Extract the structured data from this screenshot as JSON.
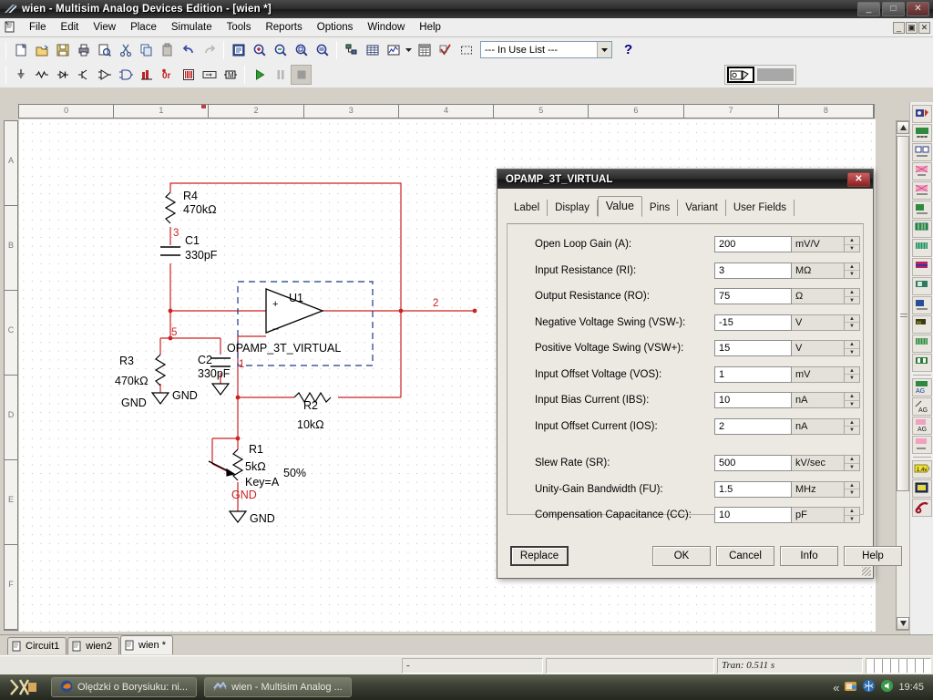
{
  "window": {
    "title": "wien - Multisim Analog Devices Edition - [wien *]",
    "minimize": "_",
    "maximize": "□",
    "close": "✕",
    "mdi_minimize": "_",
    "mdi_restore": "▣",
    "mdi_close": "✕"
  },
  "menu": {
    "items": [
      "File",
      "Edit",
      "View",
      "Place",
      "Simulate",
      "Tools",
      "Reports",
      "Options",
      "Window",
      "Help"
    ]
  },
  "toolbar": {
    "standard": [
      {
        "name": "new-file-icon",
        "label": "New"
      },
      {
        "name": "open-file-icon",
        "label": "Open"
      },
      {
        "name": "save-icon",
        "label": "Save"
      },
      {
        "name": "print-icon",
        "label": "Print"
      },
      {
        "name": "print-preview-icon",
        "label": "Print Preview"
      },
      {
        "name": "cut-icon",
        "label": "Cut"
      },
      {
        "name": "copy-icon",
        "label": "Copy"
      },
      {
        "name": "paste-icon",
        "label": "Paste"
      },
      {
        "name": "undo-icon",
        "label": "Undo"
      },
      {
        "name": "redo-icon",
        "label": "Redo"
      }
    ],
    "view": [
      {
        "name": "full-screen-icon",
        "label": "Toggle full screen"
      },
      {
        "name": "zoom-in-icon",
        "label": "Zoom In"
      },
      {
        "name": "zoom-out-icon",
        "label": "Zoom Out"
      },
      {
        "name": "zoom-area-icon",
        "label": "Zoom Area"
      },
      {
        "name": "zoom-fit-icon",
        "label": "Zoom Fit to page"
      }
    ],
    "design": [
      {
        "name": "design-toolbox-icon",
        "label": "Design Toolbox"
      },
      {
        "name": "spreadsheet-view-icon",
        "label": "Spreadsheet View"
      },
      {
        "name": "grapher-icon",
        "label": "Grapher"
      },
      {
        "name": "grapher-dropdown-icon",
        "label": "Analyses"
      },
      {
        "name": "postprocessor-icon",
        "label": "Postprocessor"
      },
      {
        "name": "erc-icon",
        "label": "Electrical Rules Check"
      },
      {
        "name": "area-capture-icon",
        "label": "Capture Screen Area"
      }
    ],
    "in_use_list": {
      "value": "--- In Use List ---",
      "options": [
        "--- In Use List ---"
      ]
    },
    "help_button": "?",
    "components": [
      {
        "name": "source-icon",
        "label": "Place Source"
      },
      {
        "name": "basic-icon",
        "label": "Place Basic"
      },
      {
        "name": "diode-icon",
        "label": "Place Diode"
      },
      {
        "name": "transistor-icon",
        "label": "Place Transistor"
      },
      {
        "name": "analog-icon",
        "label": "Place Analog"
      },
      {
        "name": "ttl-icon",
        "label": "Place TTL"
      },
      {
        "name": "cmos-icon",
        "label": "Place CMOS"
      },
      {
        "name": "misc-digital-icon",
        "label": "Place Misc Digital"
      },
      {
        "name": "mixed-icon",
        "label": "Place Mixed"
      },
      {
        "name": "indicator-icon",
        "label": "Place Indicator"
      },
      {
        "name": "misc-icon",
        "label": "Place Misc"
      }
    ],
    "simulation": [
      {
        "name": "run-icon",
        "label": "Run"
      },
      {
        "name": "pause-icon",
        "label": "Pause"
      },
      {
        "name": "stop-icon",
        "label": "Stop"
      }
    ],
    "probe_widget": {
      "name": "measurement-probe-icon",
      "label": "Measurement Probe"
    }
  },
  "rulers": {
    "horizontal": [
      "0",
      "1",
      "2",
      "3",
      "4",
      "5",
      "6",
      "7",
      "8"
    ],
    "vertical": [
      "A",
      "B",
      "C",
      "D",
      "E",
      "F"
    ]
  },
  "schematic": {
    "components": [
      {
        "ref": "R4",
        "value": "470kΩ"
      },
      {
        "ref": "C1",
        "value": "330pF"
      },
      {
        "ref": "R3",
        "value": "470kΩ"
      },
      {
        "ref": "C2",
        "value": "330pF"
      },
      {
        "ref": "U1",
        "value": "OPAMP_3T_VIRTUAL"
      },
      {
        "ref": "R2",
        "value": "10kΩ"
      },
      {
        "ref": "R1",
        "value": "5kΩ",
        "key": "Key=A",
        "setting": "50%"
      }
    ],
    "nodes": [
      "3",
      "5",
      "1",
      "2"
    ],
    "ground_labels": [
      "GND",
      "GND",
      "GND",
      "GND"
    ],
    "net_label": "GND",
    "opamp_plus": "+",
    "opamp_minus": "−"
  },
  "dialog": {
    "title": "OPAMP_3T_VIRTUAL",
    "close": "✕",
    "tabs": [
      "Label",
      "Display",
      "Value",
      "Pins",
      "Variant",
      "User Fields"
    ],
    "active_tab": "Value",
    "fields": [
      {
        "label": "Open Loop Gain (A):",
        "value": "200",
        "unit": "mV/V"
      },
      {
        "label": "Input Resistance (RI):",
        "value": "3",
        "unit": "MΩ"
      },
      {
        "label": "Output Resistance (RO):",
        "value": "75",
        "unit": "Ω"
      },
      {
        "label": "Negative Voltage Swing (VSW-):",
        "value": "-15",
        "unit": "V"
      },
      {
        "label": "Positive Voltage Swing (VSW+):",
        "value": "15",
        "unit": "V"
      },
      {
        "label": "Input Offset Voltage (VOS):",
        "value": "1",
        "unit": "mV"
      },
      {
        "label": "Input Bias Current (IBS):",
        "value": "10",
        "unit": "nA"
      },
      {
        "label": "Input Offset Current (IOS):",
        "value": "2",
        "unit": "nA"
      },
      {
        "label": "Slew Rate (SR):",
        "value": "500",
        "unit": "kV/sec"
      },
      {
        "label": "Unity-Gain Bandwidth (FU):",
        "value": "1.5",
        "unit": "MHz"
      },
      {
        "label": "Compensation Capacitance (CC):",
        "value": "10",
        "unit": "pF"
      }
    ],
    "buttons": {
      "replace": "Replace",
      "ok": "OK",
      "cancel": "Cancel",
      "info": "Info",
      "help": "Help"
    }
  },
  "sheet_tabs": [
    {
      "label": "Circuit1",
      "active": false
    },
    {
      "label": "wien2",
      "active": false
    },
    {
      "label": "wien *",
      "active": true
    }
  ],
  "statusbar": {
    "left": "-",
    "middle": "",
    "simulation": "Tran: 0.511 s"
  },
  "taskbar": {
    "items": [
      {
        "label": "Olędzki o Borysiuku: ni...",
        "icon": "firefox-icon",
        "active": false
      },
      {
        "label": "wien - Multisim Analog ...",
        "icon": "multisim-icon",
        "active": true
      }
    ],
    "tray_chevron": "«",
    "clock": "19:45"
  },
  "colors": {
    "wire": "#cc2222",
    "component": "#000000",
    "selection": "#1a3a8a",
    "node_label": "#cc2222",
    "accent": "#00007a"
  }
}
